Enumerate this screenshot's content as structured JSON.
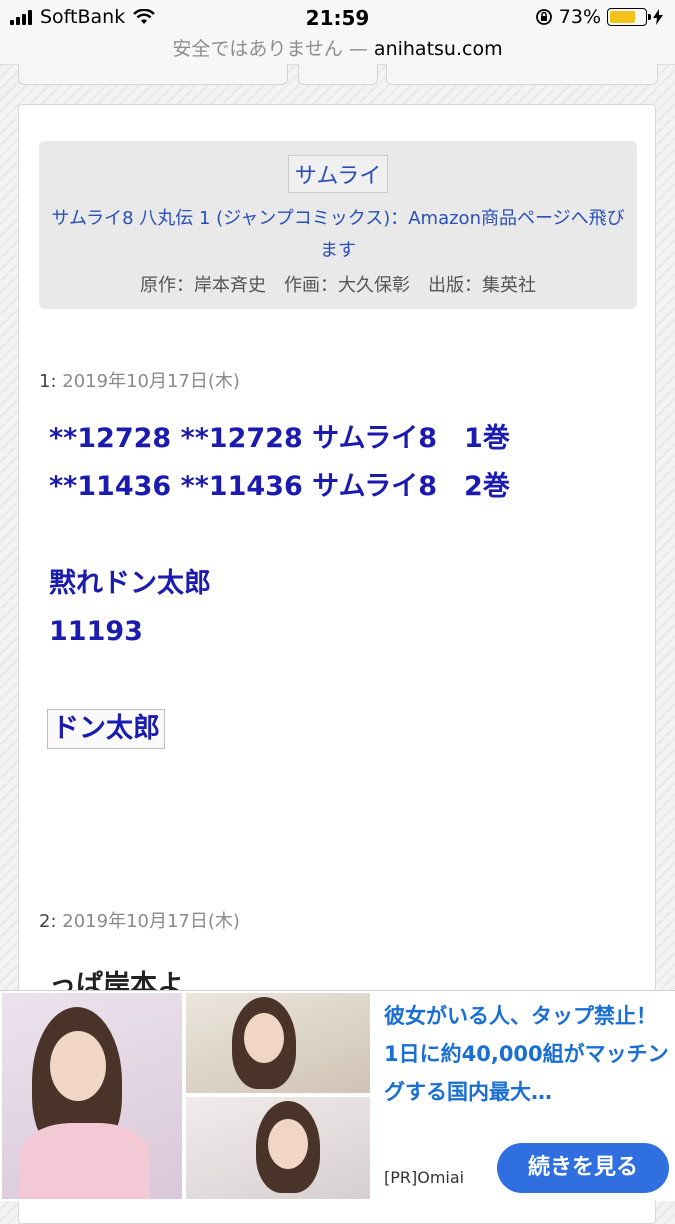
{
  "status_bar": {
    "carrier": "SoftBank",
    "time": "21:59",
    "battery": "73%",
    "battery_level": 0.73
  },
  "url_bar": {
    "security_text": "安全ではありません —",
    "domain": "anihatsu.com"
  },
  "book": {
    "tag": "サムライ",
    "link_text": "サムライ8 八丸伝 1 (ジャンプコミックス)：Amazon商品ページへ飛びます",
    "credit": "原作：岸本斉史　作画：大久保彰　出版：集英社"
  },
  "posts": [
    {
      "number": "1:",
      "date": "2019年10月17日(木)",
      "lines": [
        "**12728 **12728 サムライ8　1巻",
        "**11436 **11436 サムライ8　2巻",
        "黙れドン太郎",
        "11193"
      ],
      "tag": "ドン太郎"
    },
    {
      "number": "2:",
      "date": "2019年10月17日(木)",
      "text": "っぱ岸本よ"
    }
  ],
  "ad": {
    "headline": "彼女がいる人、タップ禁止！1日に約40,000組がマッチングする国内最大…",
    "sponsor": "[PR]Omiai",
    "cta": "続きを見る"
  }
}
